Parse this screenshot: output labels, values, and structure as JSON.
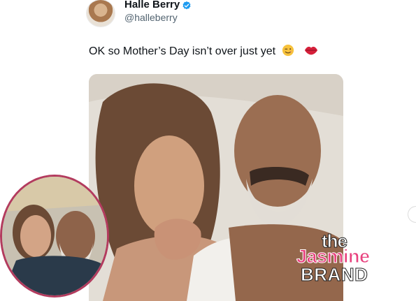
{
  "post": {
    "author_name": "Halle Berry",
    "author_handle": "@halleberry",
    "text": "OK so Mother’s Day isn’t over just yet",
    "emojis": [
      "winking-face",
      "kiss-mark"
    ]
  },
  "watermark": {
    "line1": "the",
    "line2": "Jasmine",
    "line3": "BRAND"
  },
  "colors": {
    "verified": "#1d9bf0",
    "watermark_pink": "#e8417e",
    "inset_border": "#b33b5e"
  }
}
